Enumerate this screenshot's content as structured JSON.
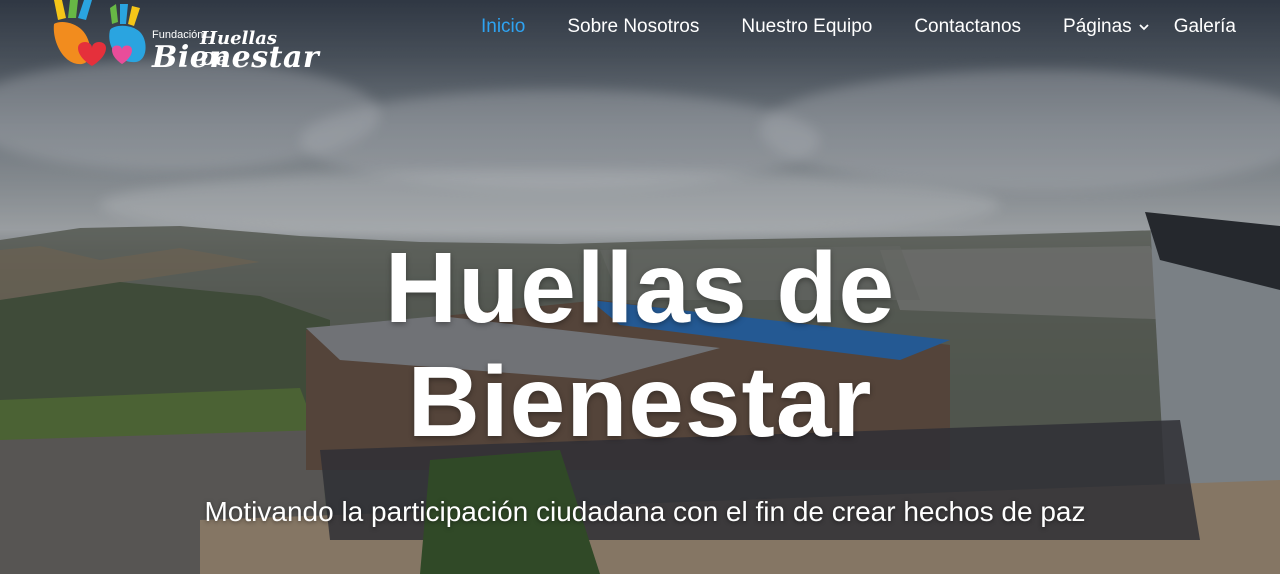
{
  "logo": {
    "small": "Fundación",
    "mid": "Huellas De",
    "big": "Bienestar"
  },
  "nav": {
    "items": [
      {
        "label": "Inicio",
        "active": true
      },
      {
        "label": "Sobre Nosotros"
      },
      {
        "label": "Nuestro Equipo"
      },
      {
        "label": "Contactanos"
      },
      {
        "label": "Páginas",
        "icon": "chevron-down-icon"
      },
      {
        "label": "Galería"
      }
    ]
  },
  "hero": {
    "title_line1": "Huellas de",
    "title_line2": "Bienestar",
    "subtitle": "Motivando la participación ciudadana con el fin de crear hechos de paz"
  },
  "colors": {
    "active_link": "#2ea3f2",
    "text": "#ffffff",
    "logo_yellow": "#f5c518",
    "logo_orange": "#f28c1e",
    "logo_red": "#e5303b",
    "logo_blue": "#2aa4e0",
    "logo_green": "#67b845",
    "logo_pink": "#e84d9a"
  }
}
